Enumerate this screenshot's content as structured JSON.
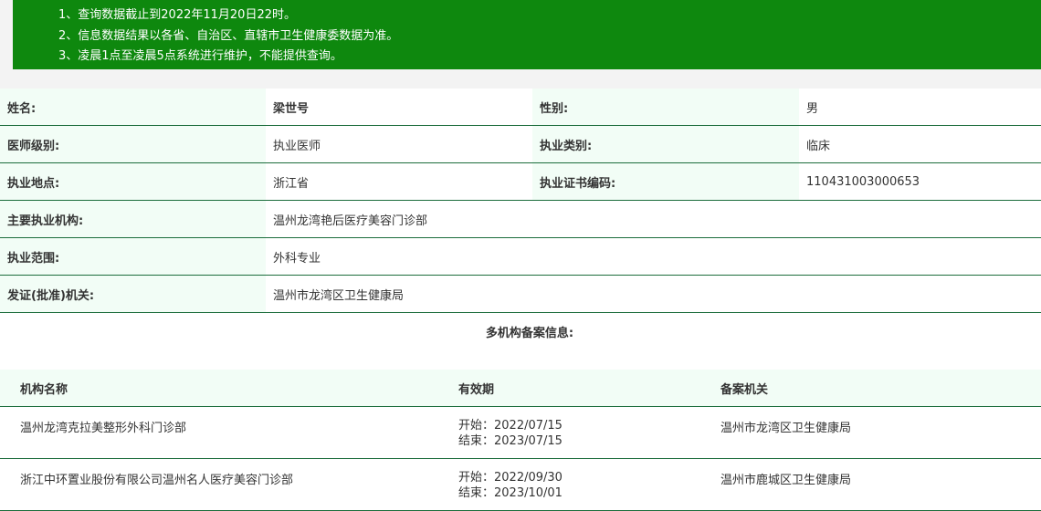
{
  "notice": [
    "1、查询数据截止到2022年11月20日22时。",
    "2、信息数据结果以各省、自治区、直辖市卫生健康委数据为准。",
    "3、凌晨1点至凌晨5点系统进行维护，不能提供查询。"
  ],
  "info": {
    "name_label": "姓名:",
    "name_value": "梁世号",
    "gender_label": "性别:",
    "gender_value": "男",
    "level_label": "医师级别:",
    "level_value": "执业医师",
    "category_label": "执业类别:",
    "category_value": "临床",
    "location_label": "执业地点:",
    "location_value": "浙江省",
    "cert_label": "执业证书编码:",
    "cert_value": "110431003000653",
    "org_label": "主要执业机构:",
    "org_value": "温州龙湾艳后医疗美容门诊部",
    "scope_label": "执业范围:",
    "scope_value": "外科专业",
    "issuer_label": "发证(批准)机关:",
    "issuer_value": "温州市龙湾区卫生健康局"
  },
  "multi": {
    "title": "多机构备案信息:",
    "headers": [
      "机构名称",
      "有效期",
      "备案机关"
    ],
    "rows": [
      {
        "org": "温州龙湾克拉美整形外科门诊部",
        "start": "开始：2022/07/15",
        "end": "结束：2023/07/15",
        "authority": "温州市龙湾区卫生健康局"
      },
      {
        "org": "浙江中环置业股份有限公司温州名人医疗美容门诊部",
        "start": "开始：2022/09/30",
        "end": "结束：2023/10/01",
        "authority": "温州市鹿城区卫生健康局"
      }
    ]
  }
}
